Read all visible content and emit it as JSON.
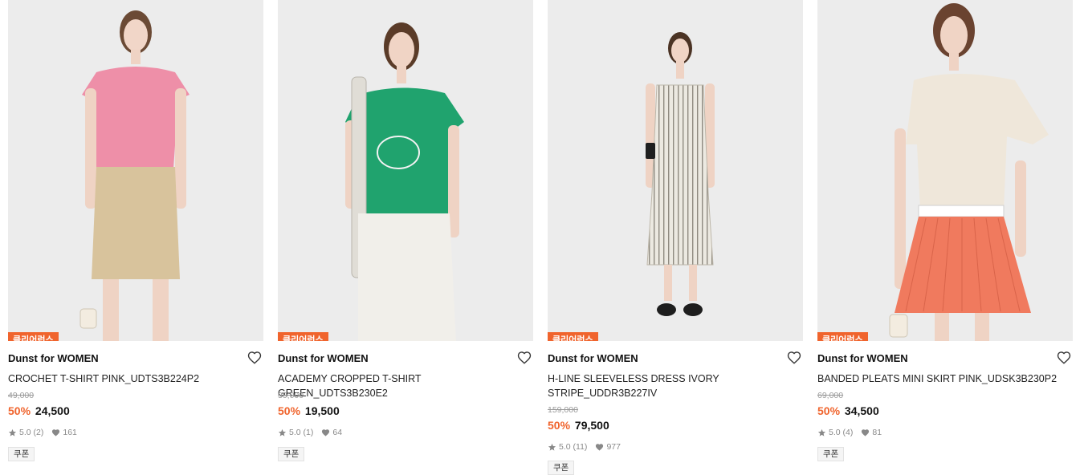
{
  "products": [
    {
      "badge": "클리어런스",
      "brand": "Dunst for WOMEN",
      "name": "CROCHET T-SHIRT PINK_UDTS3B224P2",
      "original_price": "49,000",
      "discount": "50%",
      "price": "24,500",
      "rating": "5.0",
      "review_count": "(2)",
      "likes": "161",
      "coupon": "쿠폰",
      "top_color": "#ee8fa8",
      "bottom_color": "#d8c39c"
    },
    {
      "badge": "클리어런스",
      "brand": "Dunst for WOMEN",
      "name": "ACADEMY CROPPED T-SHIRT GREEN_UDTS3B230E2",
      "original_price": "39,000",
      "discount": "50%",
      "price": "19,500",
      "rating": "5.0",
      "review_count": "(1)",
      "likes": "64",
      "coupon": "쿠폰",
      "top_color": "#20a36e",
      "bottom_color": "#f1efea"
    },
    {
      "badge": "클리어런스",
      "brand": "Dunst for WOMEN",
      "name": "H-LINE SLEEVELESS DRESS IVORY STRIPE_UDDR3B227IV",
      "original_price": "159,000",
      "discount": "50%",
      "price": "79,500",
      "rating": "5.0",
      "review_count": "(11)",
      "likes": "977",
      "coupon": "쿠폰",
      "top_color": "#ece9e1",
      "bottom_color": "#ece9e1"
    },
    {
      "badge": "클리어런스",
      "brand": "Dunst for WOMEN",
      "name": "BANDED PLEATS MINI SKIRT PINK_UDSK3B230P2",
      "original_price": "69,000",
      "discount": "50%",
      "price": "34,500",
      "rating": "5.0",
      "review_count": "(4)",
      "likes": "81",
      "coupon": "쿠폰",
      "top_color": "#efe7da",
      "bottom_color": "#f07a5e"
    }
  ]
}
